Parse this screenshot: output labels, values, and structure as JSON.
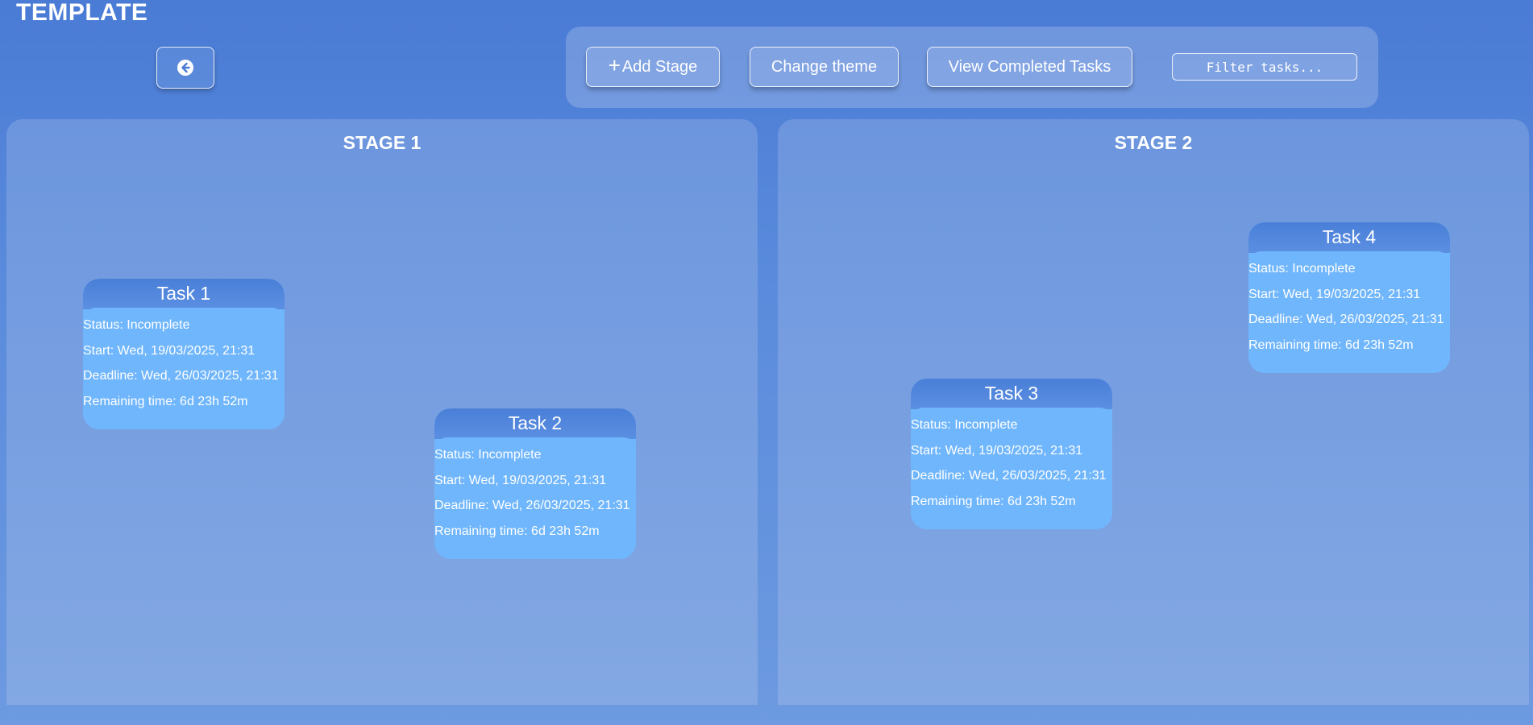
{
  "app": {
    "title": "TEMPLATE"
  },
  "icons": {
    "back": "arrow-left-circle-icon",
    "add": "plus-icon"
  },
  "toolbar": {
    "add_stage_plus": "+",
    "add_stage_label": "Add Stage",
    "change_theme_label": "Change theme",
    "view_completed_label": "View Completed Tasks",
    "filter_placeholder": "Filter tasks..."
  },
  "colors": {
    "background": "#4a7bd5",
    "task_card": "#70b6fc",
    "task_header": "#4a7fd8",
    "text": "#ffffff"
  },
  "stages": [
    {
      "title": "STAGE 1",
      "tasks": [
        {
          "title": "Task 1",
          "status": "Status: Incomplete",
          "start": "Start: Wed, 19/03/2025, 21:31",
          "deadline": "Deadline: Wed, 26/03/2025, 21:31",
          "remaining": "Remaining time: 6d 23h 52m"
        },
        {
          "title": "Task 2",
          "status": "Status: Incomplete",
          "start": "Start: Wed, 19/03/2025, 21:31",
          "deadline": "Deadline: Wed, 26/03/2025, 21:31",
          "remaining": "Remaining time: 6d 23h 52m"
        }
      ]
    },
    {
      "title": "STAGE 2",
      "tasks": [
        {
          "title": "Task 3",
          "status": "Status: Incomplete",
          "start": "Start: Wed, 19/03/2025, 21:31",
          "deadline": "Deadline: Wed, 26/03/2025, 21:31",
          "remaining": "Remaining time: 6d 23h 52m"
        },
        {
          "title": "Task 4",
          "status": "Status: Incomplete",
          "start": "Start: Wed, 19/03/2025, 21:31",
          "deadline": "Deadline: Wed, 26/03/2025, 21:31",
          "remaining": "Remaining time: 6d 23h 52m"
        }
      ]
    }
  ]
}
